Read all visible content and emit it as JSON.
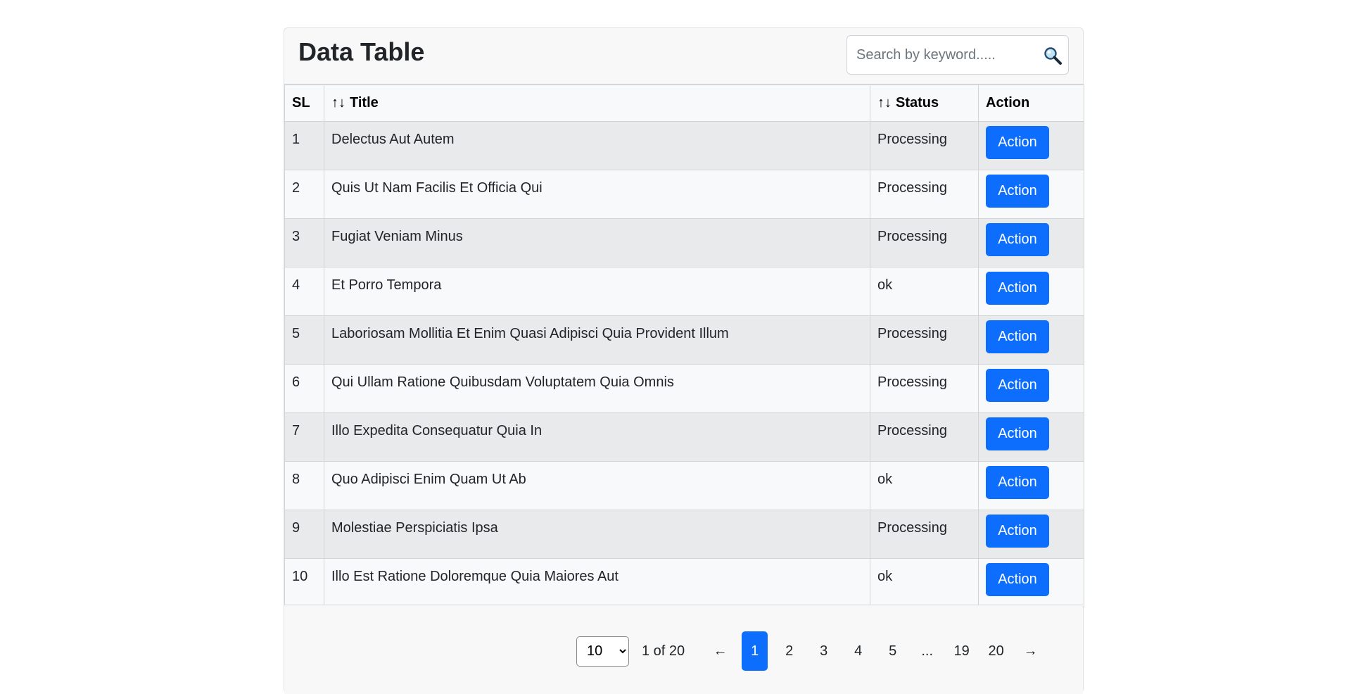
{
  "header": {
    "title": "Data Table",
    "search_placeholder": "Search by keyword....."
  },
  "table": {
    "columns": [
      "SL",
      "Title",
      "Status",
      "Action"
    ],
    "sort_indicator": "↑↓",
    "rows": [
      {
        "sl": "1",
        "title": "Delectus Aut Autem",
        "status": "Processing",
        "action": "Action"
      },
      {
        "sl": "2",
        "title": "Quis Ut Nam Facilis Et Officia Qui",
        "status": "Processing",
        "action": "Action"
      },
      {
        "sl": "3",
        "title": "Fugiat Veniam Minus",
        "status": "Processing",
        "action": "Action"
      },
      {
        "sl": "4",
        "title": "Et Porro Tempora",
        "status": "ok",
        "action": "Action"
      },
      {
        "sl": "5",
        "title": "Laboriosam Mollitia Et Enim Quasi Adipisci Quia Provident Illum",
        "status": "Processing",
        "action": "Action"
      },
      {
        "sl": "6",
        "title": "Qui Ullam Ratione Quibusdam Voluptatem Quia Omnis",
        "status": "Processing",
        "action": "Action"
      },
      {
        "sl": "7",
        "title": "Illo Expedita Consequatur Quia In",
        "status": "Processing",
        "action": "Action"
      },
      {
        "sl": "8",
        "title": "Quo Adipisci Enim Quam Ut Ab",
        "status": "ok",
        "action": "Action"
      },
      {
        "sl": "9",
        "title": "Molestiae Perspiciatis Ipsa",
        "status": "Processing",
        "action": "Action"
      },
      {
        "sl": "10",
        "title": "Illo Est Ratione Doloremque Quia Maiores Aut",
        "status": "ok",
        "action": "Action"
      }
    ]
  },
  "pagination": {
    "page_size": "10",
    "page_info": "1 of 20",
    "prev": "←",
    "next": "→",
    "pages": [
      "1",
      "2",
      "3",
      "4",
      "5",
      "...",
      "19",
      "20"
    ],
    "active_page": "1"
  },
  "colors": {
    "accent": "#0d6efd",
    "row_odd": "#e9eaeb",
    "row_even": "#f8f9fa"
  },
  "icons": {
    "search": "search-icon"
  }
}
